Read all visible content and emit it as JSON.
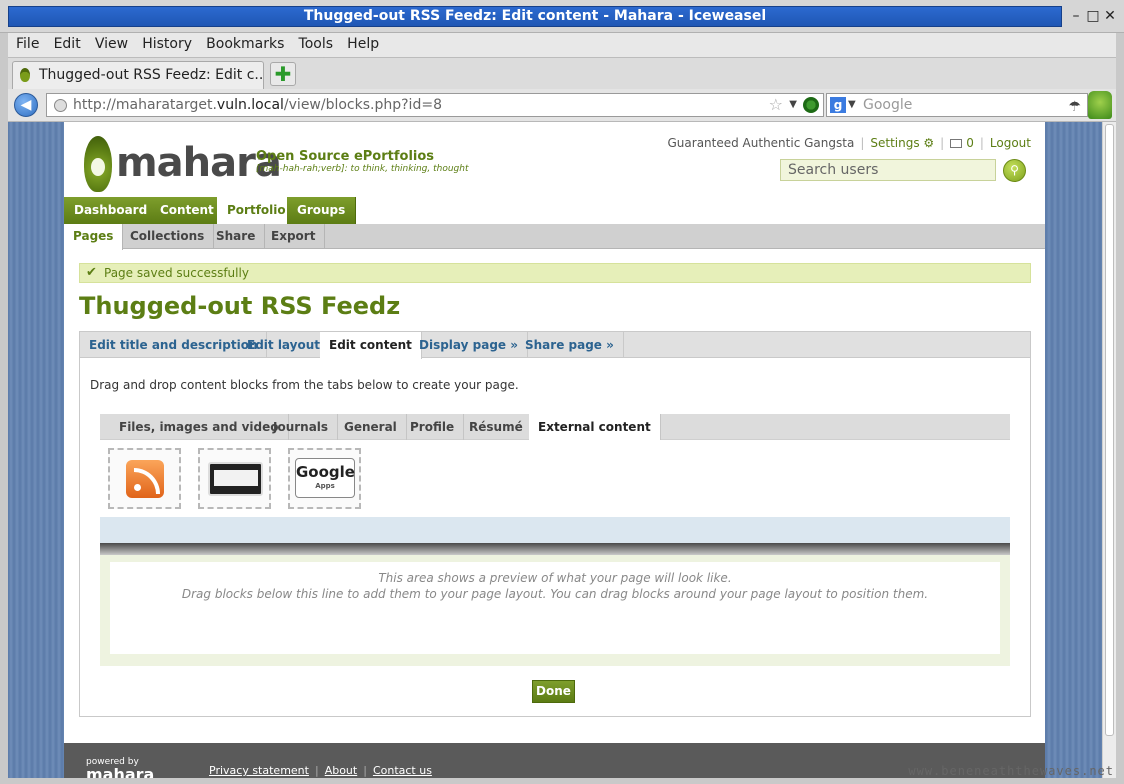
{
  "window": {
    "title": "Thugged-out RSS Feedz: Edit content - Mahara - Iceweasel"
  },
  "menubar": {
    "items": [
      "File",
      "Edit",
      "View",
      "History",
      "Bookmarks",
      "Tools",
      "Help"
    ]
  },
  "browser_tab": {
    "label": "Thugged-out RSS Feedz: Edit c..."
  },
  "navbar": {
    "url_prefix": "http://maharatarget.",
    "url_host": "vuln.local",
    "url_path": "/view/blocks.php?id=8",
    "search_placeholder": "Google"
  },
  "site": {
    "logo_text": "mahara",
    "logo_subtitle": "Open Source ePortfolios",
    "logo_tagline": "[mah-hah-rah;verb]: to think, thinking, thought"
  },
  "userbox": {
    "username": "Guaranteed Authentic Gangsta",
    "settings": "Settings",
    "inbox_count": "0",
    "logout": "Logout",
    "search_placeholder": "Search users"
  },
  "mainnav": {
    "items": [
      "Dashboard",
      "Content",
      "Portfolio",
      "Groups"
    ],
    "active": "Portfolio"
  },
  "subnav": {
    "items": [
      "Pages",
      "Collections",
      "Share",
      "Export"
    ],
    "active": "Pages"
  },
  "notice": {
    "text": "Page saved successfully"
  },
  "page": {
    "title": "Thugged-out RSS Feedz"
  },
  "edit_tabs": {
    "items": [
      "Edit title and description",
      "Edit layout",
      "Edit content",
      "Display page »",
      "Share page »"
    ],
    "active": "Edit content"
  },
  "instructions": "Drag and drop content blocks from the tabs below to create your page.",
  "category_tabs": {
    "items": [
      "Files, images and video",
      "Journals",
      "General",
      "Profile",
      "Résumé",
      "External content"
    ],
    "active": "External content"
  },
  "blocks": [
    {
      "icon": "rss-feed-icon"
    },
    {
      "icon": "external-video-icon"
    },
    {
      "icon": "google-apps-icon",
      "text_main": "Google",
      "text_sub": "Apps"
    }
  ],
  "preview": {
    "line1": "This area shows a preview of what your page will look like.",
    "line2": "Drag blocks below this line to add them to your page layout. You can drag blocks around your page layout to position them."
  },
  "done_label": "Done",
  "footer": {
    "powered_by": "powered by",
    "powered_logo": "mahara",
    "links": [
      "Privacy statement",
      "About",
      "Contact us"
    ]
  },
  "watermark": "www.beneneaththewaves.net"
}
